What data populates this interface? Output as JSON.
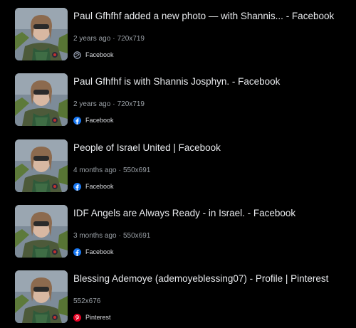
{
  "results": [
    {
      "title": "Paul Gfhfhf added a new photo — with Shannis... - Facebook",
      "age": "2 years ago",
      "separator": "·",
      "dimensions": "720x719",
      "source": "Facebook",
      "source_icon": "globe-icon"
    },
    {
      "title": "Paul Gfhfhf is with Shannis Josphyn. - Facebook",
      "age": "2 years ago",
      "separator": "·",
      "dimensions": "720x719",
      "source": "Facebook",
      "source_icon": "facebook-icon"
    },
    {
      "title": "People of Israel United | Facebook",
      "age": "4 months ago",
      "separator": "·",
      "dimensions": "550x691",
      "source": "Facebook",
      "source_icon": "facebook-icon"
    },
    {
      "title": "IDF Angels are Always Ready - in Israel. - Facebook",
      "age": "3 months ago",
      "separator": "·",
      "dimensions": "550x691",
      "source": "Facebook",
      "source_icon": "facebook-icon"
    },
    {
      "title": "Blessing Ademoye (ademoyeblessing07) - Profile | Pinterest",
      "dimensions": "552x676",
      "source": "Pinterest",
      "source_icon": "pinterest-icon"
    }
  ],
  "colors": {
    "background": "#000000",
    "title_text": "#e8eaed",
    "meta_text": "#9aa0a6",
    "facebook_blue": "#1877f2",
    "pinterest_red": "#e60023"
  }
}
